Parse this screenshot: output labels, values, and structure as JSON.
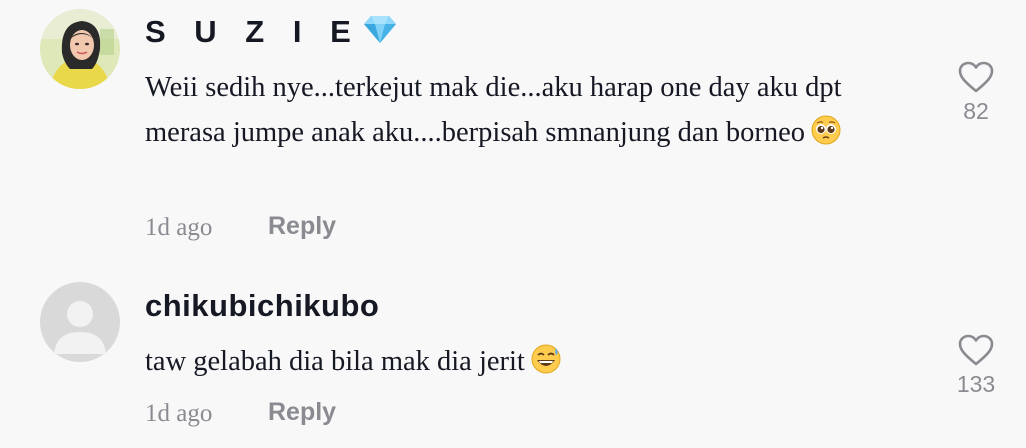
{
  "comments": [
    {
      "username": "S U Z I E",
      "badge_icon": "diamond-icon",
      "text": "Weii sedih nye...terkejut mak die...aku harap one day aku dpt merasa jumpe anak aku....berpisah smnanjung dan borneo",
      "emoji_icon": "pleading-face-icon",
      "time": "1d ago",
      "reply_label": "Reply",
      "likes": "82"
    },
    {
      "username": "chikubichikubo",
      "text": "taw gelabah dia bila mak dia jerit",
      "emoji_icon": "grinning-sweat-face-icon",
      "time": "1d ago",
      "reply_label": "Reply",
      "likes": "133"
    }
  ],
  "colors": {
    "background": "#f8f8f8",
    "text_primary": "#161823",
    "text_secondary": "#8a8b91",
    "diamond": "#5fc3f2"
  }
}
